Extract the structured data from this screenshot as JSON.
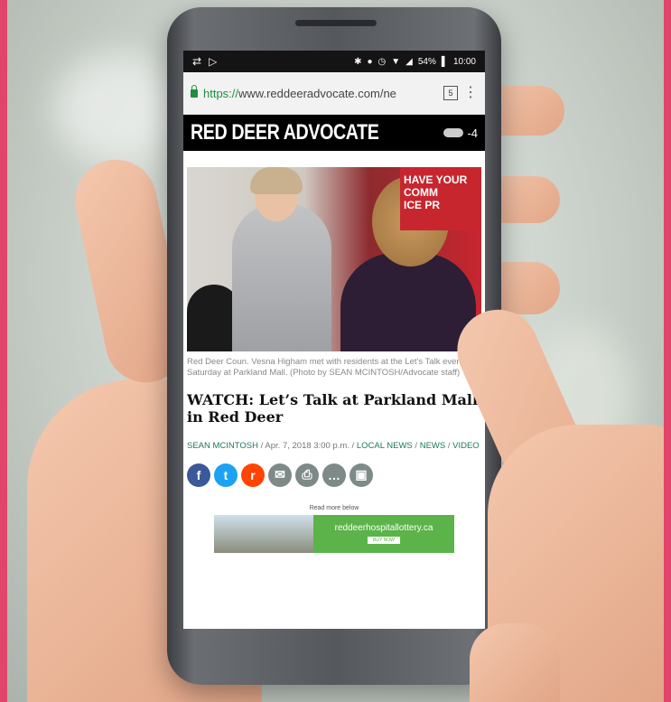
{
  "status_bar": {
    "left_icons": [
      "data-icon",
      "play-store-icon"
    ],
    "battery": "54%",
    "time": "10:00"
  },
  "browser": {
    "url_https": "https://",
    "url_rest": "www.reddeeradvocate.com/ne",
    "tab_count": "5"
  },
  "masthead": {
    "title": "RED DEER ADVOCATE",
    "temperature": "-4"
  },
  "article": {
    "photo_sign": "HAVE YOUR\nCOMM\nICE PR",
    "caption": "Red Deer Coun. Vesna Higham met with residents at the Let's Talk event Saturday at Parkland Mall. (Photo by SEAN MCINTOSH/Advocate staff)",
    "headline": "WATCH: Let’s Talk at Parkland Mall in Red Deer",
    "author": "SEAN MCINTOSH",
    "date": "Apr. 7, 2018 3:00 p.m.",
    "categories": [
      "LOCAL NEWS",
      "NEWS",
      "VIDEO"
    ]
  },
  "share_buttons": [
    {
      "name": "facebook",
      "glyph": "f",
      "color": "#3b5998"
    },
    {
      "name": "twitter",
      "glyph": "t",
      "color": "#1da1f2"
    },
    {
      "name": "reddit",
      "glyph": "r",
      "color": "#ff4500"
    },
    {
      "name": "email",
      "glyph": "✉",
      "color": "#7d8a87"
    },
    {
      "name": "print",
      "glyph": "⎙",
      "color": "#7d8a87"
    },
    {
      "name": "comment",
      "glyph": "…",
      "color": "#7d8a87"
    },
    {
      "name": "image",
      "glyph": "▣",
      "color": "#7d8a87"
    }
  ],
  "ad": {
    "read_more": "Read more below",
    "site": "reddeerhospitallottery.ca",
    "button": "BUY NOW"
  },
  "colors": {
    "frame": "#e2456b",
    "link_green": "#1d7a57"
  }
}
